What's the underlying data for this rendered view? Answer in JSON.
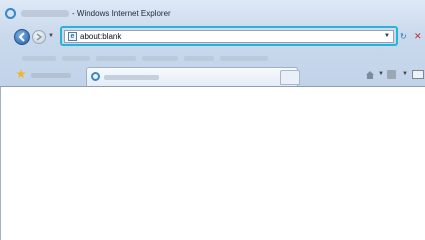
{
  "window": {
    "title": "- Windows Internet Explorer"
  },
  "navigation": {
    "address_value": "about:blank"
  },
  "icons": {
    "app": "ie-icon",
    "back": "back-arrow-icon",
    "forward": "forward-arrow-icon",
    "page": "page-icon",
    "refresh": "refresh-icon",
    "stop": "stop-icon",
    "favorites": "star-icon",
    "tab": "ie-icon",
    "home": "home-icon",
    "feeds": "feeds-icon",
    "print": "print-icon"
  },
  "colors": {
    "highlight": "#2bb3d6",
    "chrome": "#cad9ec",
    "stop": "#c0302b"
  }
}
